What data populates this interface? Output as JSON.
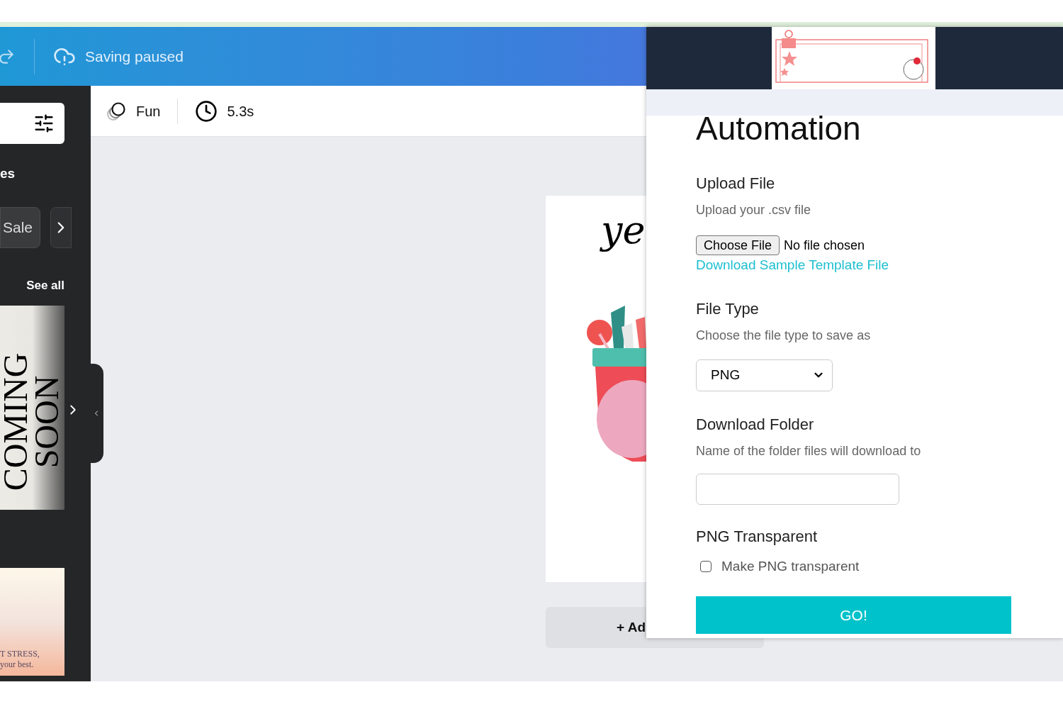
{
  "header": {
    "status": "Saving paused"
  },
  "toolbar": {
    "animation": "Fun",
    "duration": "5.3s"
  },
  "sidebar": {
    "partial_heading": "es",
    "chip": "Sale",
    "see_all": "See all",
    "thumbnails": [
      {
        "kind": "vertical",
        "lines": [
          "COMING",
          "SOON"
        ]
      },
      {
        "kind": "gradient",
        "lines": [
          "T STRESS,",
          "your best."
        ]
      }
    ]
  },
  "canvas": {
    "page_text": "ye",
    "add_page": "+ Ad"
  },
  "panel": {
    "title": "Automation",
    "upload": {
      "heading": "Upload File",
      "hint": "Upload your .csv file",
      "button": "Choose File",
      "status": "No file chosen",
      "link": "Download Sample Template File"
    },
    "file_type": {
      "heading": "File Type",
      "hint": "Choose the file type to save as",
      "value": "PNG"
    },
    "folder": {
      "heading": "Download Folder",
      "hint": "Name of the folder files will download to"
    },
    "transparent": {
      "heading": "PNG Transparent",
      "label": "Make PNG transparent",
      "checked": false
    },
    "go": "GO!"
  }
}
